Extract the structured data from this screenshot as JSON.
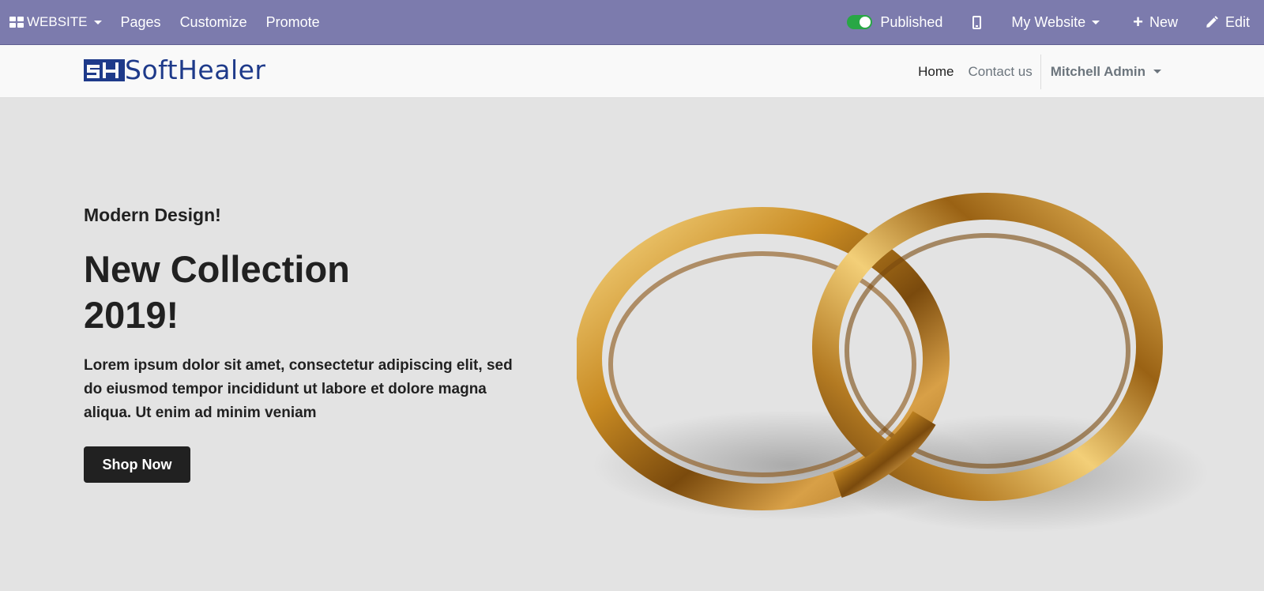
{
  "admin_bar": {
    "website_label": "WEBSITE",
    "menu": [
      "Pages",
      "Customize",
      "Promote"
    ],
    "published_label": "Published",
    "my_website_label": "My Website",
    "new_label": "New",
    "edit_label": "Edit",
    "accent_color": "#7c7bad",
    "toggle_color": "#28a745"
  },
  "header": {
    "logo_text": "SoftHealer",
    "nav": {
      "home": "Home",
      "contact": "Contact us",
      "user": "Mitchell Admin"
    },
    "brand_color": "#1e3a8a"
  },
  "hero": {
    "subtitle": "Modern Design!",
    "title": "New Collection 2019!",
    "text": "Lorem ipsum dolor sit amet, consectetur adipiscing elit, sed do eiusmod tempor incididunt ut labore et dolore magna aliqua. Ut enim ad minim veniam",
    "button_label": "Shop Now",
    "image": "gold-wedding-rings-image"
  }
}
